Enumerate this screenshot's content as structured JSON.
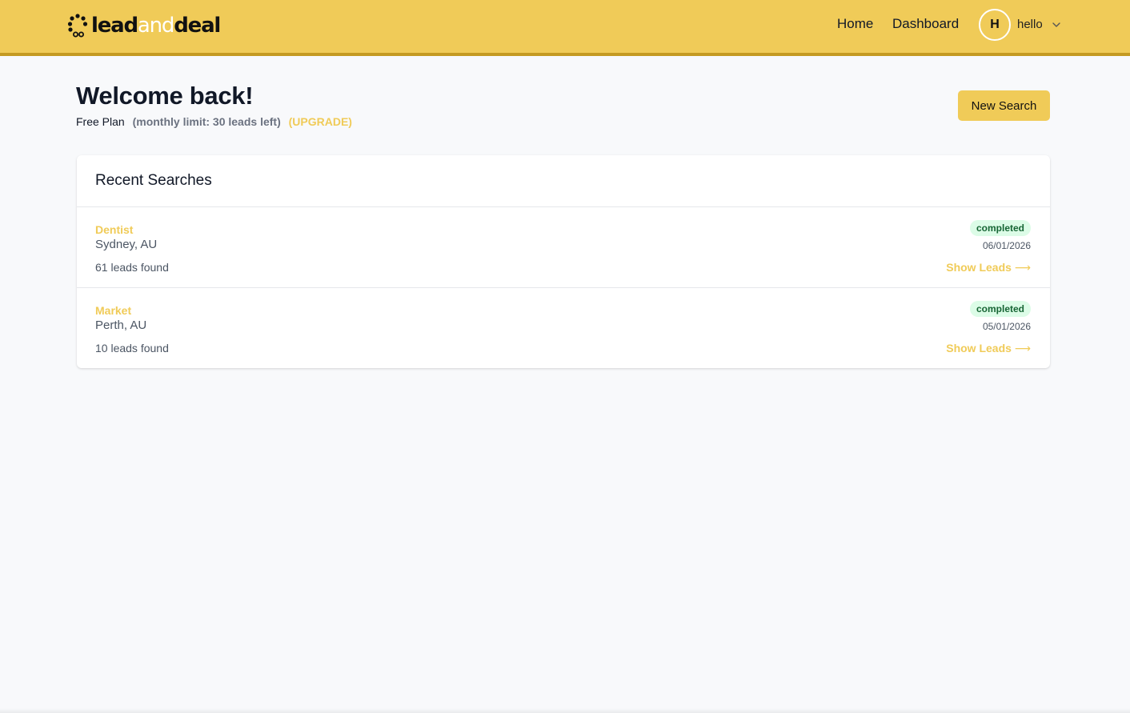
{
  "brand": {
    "logo_lead": "lead",
    "logo_and": "and",
    "logo_deal": "deal",
    "primary_color": "#f0cb58"
  },
  "nav": {
    "home": "Home",
    "dashboard": "Dashboard"
  },
  "user": {
    "initial": "H",
    "name": "hello",
    "menu_icon": "chevron-down-icon"
  },
  "welcome": {
    "title": "Welcome back!",
    "plan": "Free Plan",
    "limit": "(monthly limit: 30 leads left)",
    "upgrade": "(UPGRADE)"
  },
  "actions": {
    "new_search": "New Search"
  },
  "recent": {
    "title": "Recent Searches",
    "items": [
      {
        "term": "Dentist",
        "location": "Sydney, AU",
        "count": "61 leads found",
        "status": "completed",
        "date": "06/01/2026",
        "action": "Show Leads"
      },
      {
        "term": "Market",
        "location": "Perth, AU",
        "count": "10 leads found",
        "status": "completed",
        "date": "05/01/2026",
        "action": "Show Leads"
      }
    ]
  },
  "colors": {
    "status_bg": "#dcfce7",
    "status_text": "#166534"
  }
}
